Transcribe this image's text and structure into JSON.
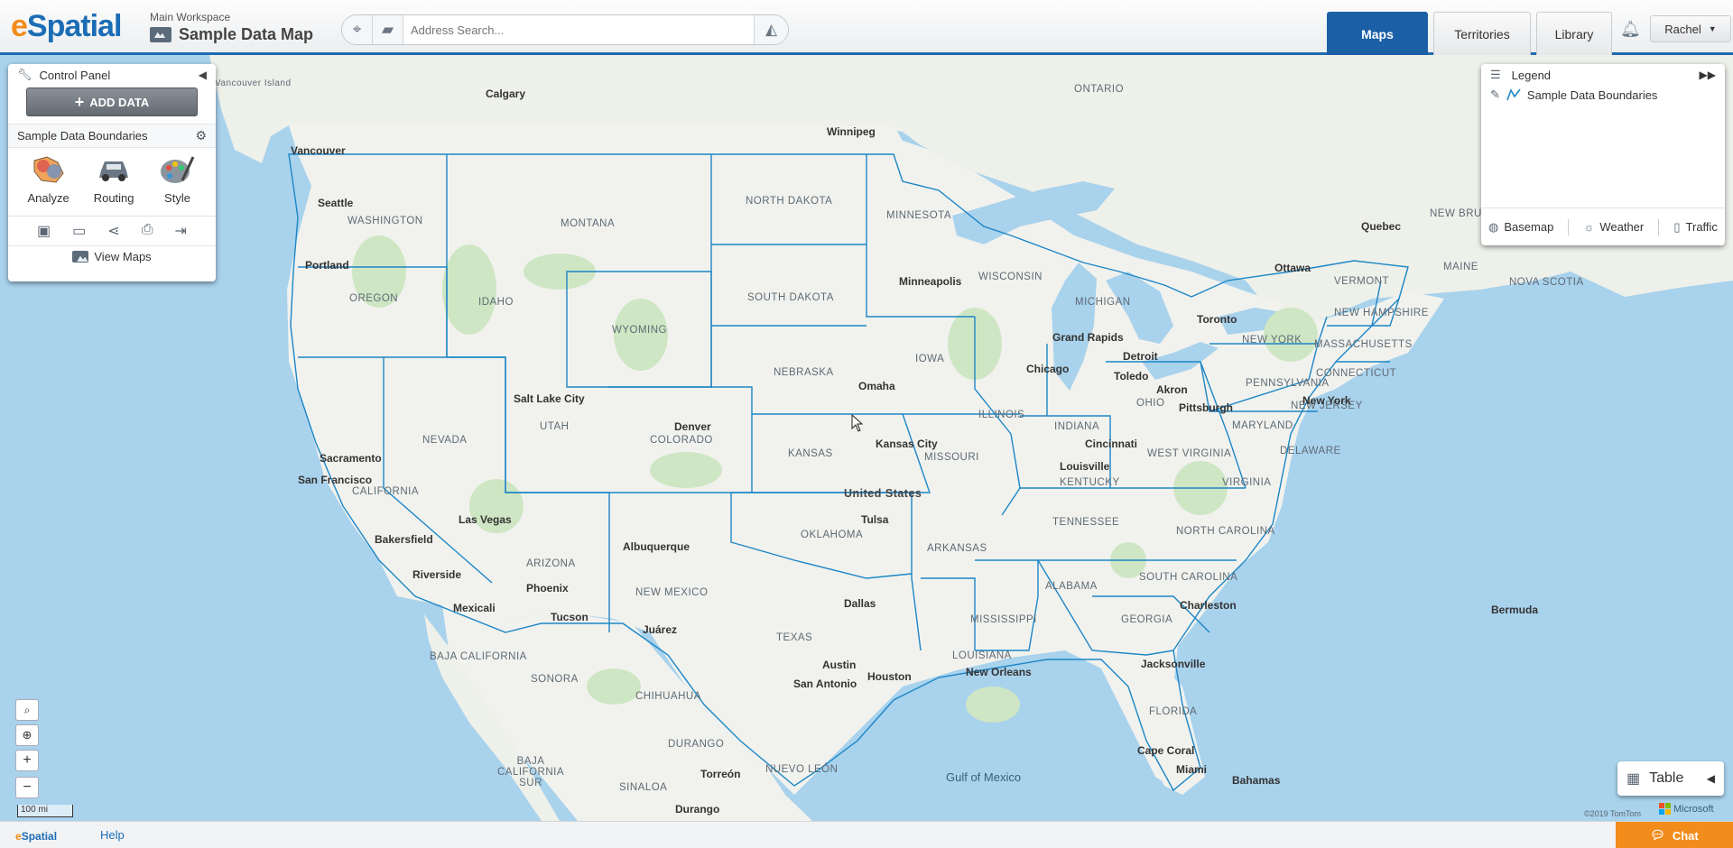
{
  "header": {
    "logo_e": "e",
    "logo_rest": "Spatial",
    "workspace_label": "Main Workspace",
    "map_title": "Sample Data Map",
    "search_placeholder": "Address Search...",
    "tabs": [
      {
        "label": "Maps",
        "active": true
      },
      {
        "label": "Territories",
        "active": false
      },
      {
        "label": "Library",
        "active": false
      }
    ],
    "user_name": "Rachel"
  },
  "control_panel": {
    "title": "Control Panel",
    "add_data_label": "ADD DATA",
    "layer_name": "Sample Data Boundaries",
    "tools": [
      {
        "label": "Analyze",
        "icon": "analyze-icon"
      },
      {
        "label": "Routing",
        "icon": "car-icon"
      },
      {
        "label": "Style",
        "icon": "palette-icon"
      }
    ],
    "actions": [
      "save-icon",
      "folder-icon",
      "share-icon",
      "print-icon",
      "export-icon"
    ],
    "view_maps_label": "View Maps"
  },
  "legend": {
    "title": "Legend",
    "layer_name": "Sample Data Boundaries",
    "footer": [
      {
        "label": "Basemap",
        "icon": "globe-icon"
      },
      {
        "label": "Weather",
        "icon": "sun-icon"
      },
      {
        "label": "Traffic",
        "icon": "traffic-light-icon"
      }
    ]
  },
  "map": {
    "scale_label": "100 mi",
    "copyright": "©2019 TomTom",
    "provider": "Microsoft",
    "cities": [
      "Calgary",
      "Winnipeg",
      "Vancouver",
      "Vancouver Island",
      "Seattle",
      "Portland",
      "Minneapolis",
      "Ottawa",
      "Quebec",
      "Toronto",
      "Grand Rapids",
      "Detroit",
      "Chicago",
      "Toledo",
      "Akron",
      "Pittsburgh",
      "New York",
      "Salt Lake City",
      "Denver",
      "Omaha",
      "Kansas City",
      "Sacramento",
      "San Francisco",
      "Las Vegas",
      "Bakersfield",
      "Riverside",
      "Mexicali",
      "Phoenix",
      "Tucson",
      "Albuquerque",
      "Juárez",
      "Tulsa",
      "Dallas",
      "Austin",
      "San Antonio",
      "Houston",
      "New Orleans",
      "Jacksonville",
      "Charleston",
      "Louisville",
      "Cincinnati",
      "Cape Coral",
      "Miami",
      "Torreón",
      "Durango",
      "Bermuda",
      "Bahamas"
    ],
    "states": [
      "ONTARIO",
      "NORTH DAKOTA",
      "MINNESOTA",
      "WASHINGTON",
      "MONTANA",
      "SOUTH DAKOTA",
      "WISCONSIN",
      "MICHIGAN",
      "OREGON",
      "IDAHO",
      "WYOMING",
      "NEBRASKA",
      "IOWA",
      "NEW YORK",
      "PENNSYLVANIA",
      "OHIO",
      "ILLINOIS",
      "INDIANA",
      "UTAH",
      "NEVADA",
      "COLORADO",
      "KANSAS",
      "MISSOURI",
      "WEST VIRGINIA",
      "VIRGINIA",
      "KENTUCKY",
      "CALIFORNIA",
      "TENNESSEE",
      "NORTH CAROLINA",
      "OKLAHOMA",
      "ARKANSAS",
      "ARIZONA",
      "NEW MEXICO",
      "SOUTH CAROLINA",
      "ALABAMA",
      "MISSISSIPPI",
      "GEORGIA",
      "TEXAS",
      "LOUISIANA",
      "FLORIDA",
      "MARYLAND",
      "DELAWARE",
      "NEW JERSEY",
      "CONNECTICUT",
      "MASSACHUSETTS",
      "NEW HAMPSHIRE",
      "VERMONT",
      "MAINE",
      "NOVA SCOTIA",
      "NEW BRUNSWICK",
      "BAJA CALIFORNIA",
      "SONORA",
      "CHIHUAHUA",
      "DURANGO",
      "BAJA CALIFORNIA SUR",
      "SINALOA",
      "NUEVO LEÓN"
    ],
    "country_label": "United States",
    "water_labels": [
      "Gulf of Mexico"
    ]
  },
  "table_button": {
    "label": "Table"
  },
  "footer": {
    "logo_e": "e",
    "logo_rest": "Spatial",
    "help": "Help",
    "chat": "Chat"
  },
  "colors": {
    "accent": "#1b5fa6",
    "logo_orange": "#f28c1b",
    "water": "#a9d2ec",
    "land": "#f1f2ee",
    "boundary": "#1c86c6"
  }
}
